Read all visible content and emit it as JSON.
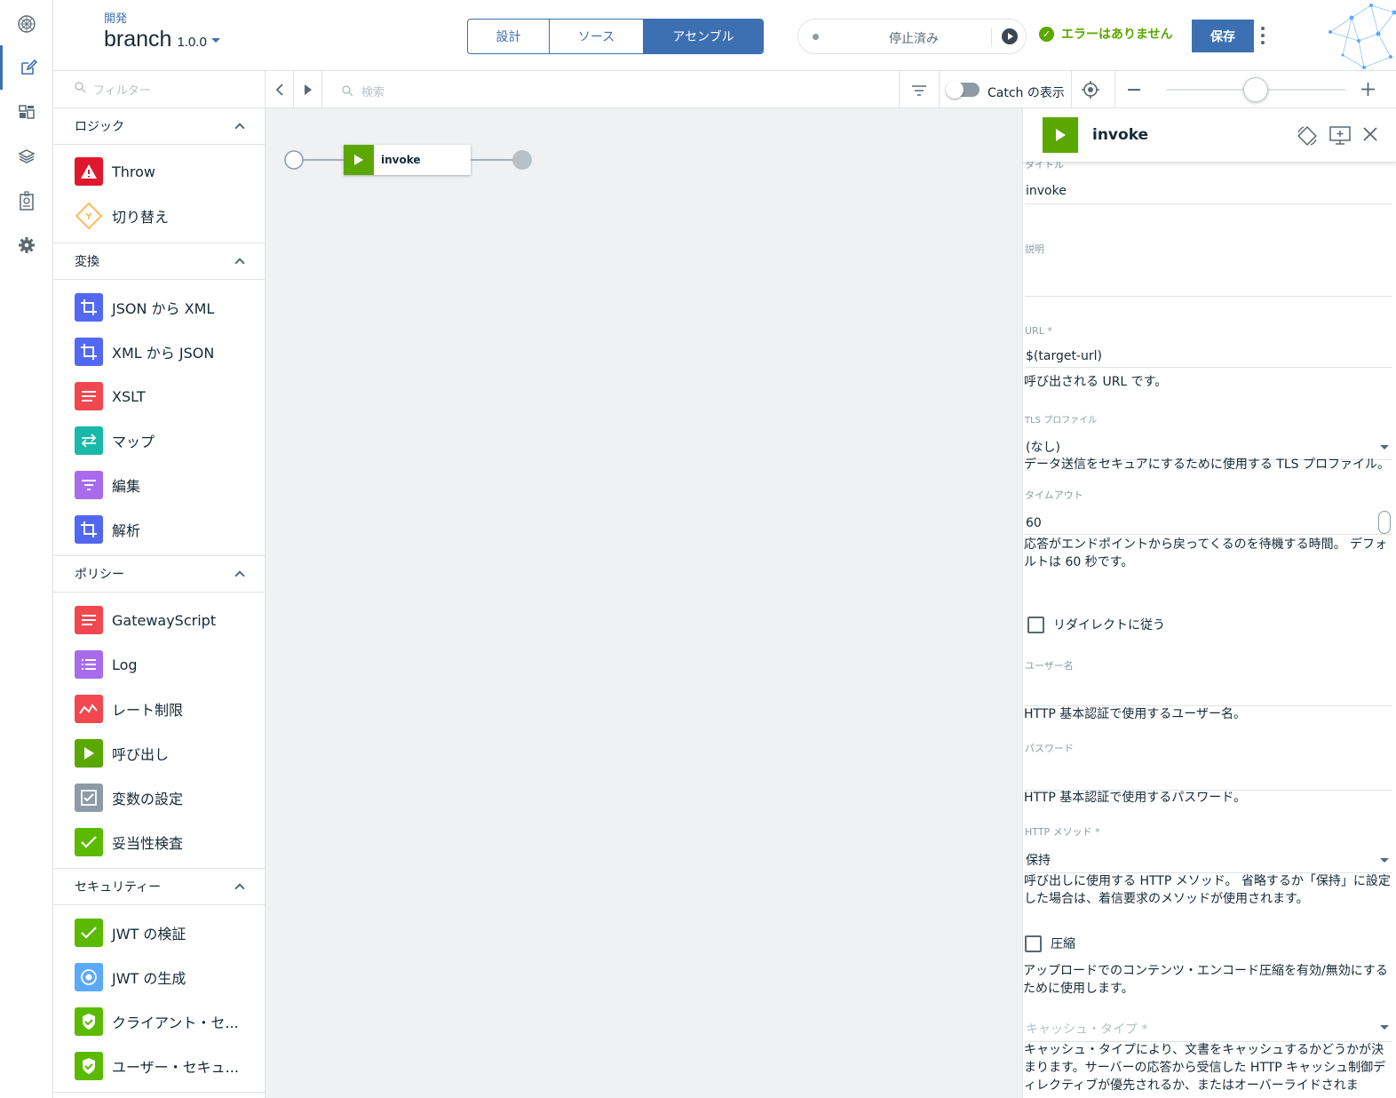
{
  "header": {
    "breadcrumb": "開発",
    "api_name": "branch",
    "version": "1.0.0",
    "tabs": [
      {
        "label": "設計",
        "selected": false
      },
      {
        "label": "ソース",
        "selected": false
      },
      {
        "label": "アセンブル",
        "selected": true
      }
    ],
    "run_status": "停止済み",
    "validation_status": "エラーはありません",
    "save_label": "保存"
  },
  "palette": {
    "filter_placeholder": "フィルター",
    "sections": [
      {
        "title": "ロジック",
        "items": [
          {
            "label": "Throw",
            "icon": "warning-icon",
            "color": "#e0182d"
          },
          {
            "label": "切り替え",
            "icon": "switch-diamond-icon",
            "color": "#fdd13a"
          }
        ]
      },
      {
        "title": "変換",
        "items": [
          {
            "label": "JSON から XML",
            "icon": "crop-icon",
            "color": "#5368f2"
          },
          {
            "label": "XML から JSON",
            "icon": "crop-icon",
            "color": "#5368f2"
          },
          {
            "label": "XSLT",
            "icon": "lines-icon",
            "color": "#f2474f"
          },
          {
            "label": "マップ",
            "icon": "arrows-exchange-icon",
            "color": "#19b8a9"
          },
          {
            "label": "編集",
            "icon": "filter-lines-icon",
            "color": "#a86bec"
          },
          {
            "label": "解析",
            "icon": "crop-icon",
            "color": "#5368f2"
          }
        ]
      },
      {
        "title": "ポリシー",
        "items": [
          {
            "label": "GatewayScript",
            "icon": "lines-icon",
            "color": "#f2474f"
          },
          {
            "label": "Log",
            "icon": "list-icon",
            "color": "#a86bec"
          },
          {
            "label": "レート制限",
            "icon": "trend-icon",
            "color": "#f2474f"
          },
          {
            "label": "呼び出し",
            "icon": "play-icon",
            "color": "#5aa700"
          },
          {
            "label": "変数の設定",
            "icon": "checkbox-icon",
            "color": "#8c9ba5"
          },
          {
            "label": "妥当性検査",
            "icon": "check-icon",
            "color": "#5aba00"
          }
        ]
      },
      {
        "title": "セキュリティー",
        "items": [
          {
            "label": "JWT の検証",
            "icon": "check-icon",
            "color": "#5aba00"
          },
          {
            "label": "JWT の生成",
            "icon": "target-icon",
            "color": "#5aaafa"
          },
          {
            "label": "クライアント・セ...",
            "icon": "shield-check-icon",
            "color": "#5aba00"
          },
          {
            "label": "ユーザー・セキュ...",
            "icon": "shield-check-icon",
            "color": "#5aba00"
          }
        ]
      }
    ]
  },
  "toolbar": {
    "search_placeholder": "検索",
    "catch_label": "Catch の表示",
    "zoom_level": 0.5
  },
  "canvas": {
    "node_label": "invoke"
  },
  "properties": {
    "title": "invoke",
    "fields": {
      "title_label": "タイトル",
      "title_value": "invoke",
      "description_label": "説明",
      "url_label": "URL *",
      "url_value": "$(target-url)",
      "url_help": "呼び出される URL です。",
      "tls_label": "TLS プロファイル",
      "tls_value": "(なし)",
      "tls_help": "データ送信をセキュアにするために使用する TLS プロファイル。",
      "timeout_label": "タイムアウト",
      "timeout_value": "60",
      "timeout_help": "応答がエンドポイントから戻ってくるのを待機する時間。 デフォルトは 60 秒です。",
      "redirect_label": "リダイレクトに従う",
      "username_label": "ユーザー名",
      "username_help": "HTTP 基本認証で使用するユーザー名。",
      "password_label": "パスワード",
      "password_help": "HTTP 基本認証で使用するパスワード。",
      "method_label": "HTTP メソッド *",
      "method_value": "保持",
      "method_help": "呼び出しに使用する HTTP メソッド。 省略するか「保持」に設定した場合は、着信要求のメソッドが使用されます。",
      "compress_label": "圧縮",
      "compress_help": "アップロードでのコンテンツ・エンコード圧縮を有効/無効にするために使用します。",
      "cache_type_placeholder": "キャッシュ・タイプ *",
      "cache_type_help": "キャッシュ・タイプにより、文書をキャッシュするかどうかが決まります。サーバーの応答から受信した HTTP キャッシュ制御ディレクティブが優先されるか、またはオーバーライドされま"
    }
  }
}
